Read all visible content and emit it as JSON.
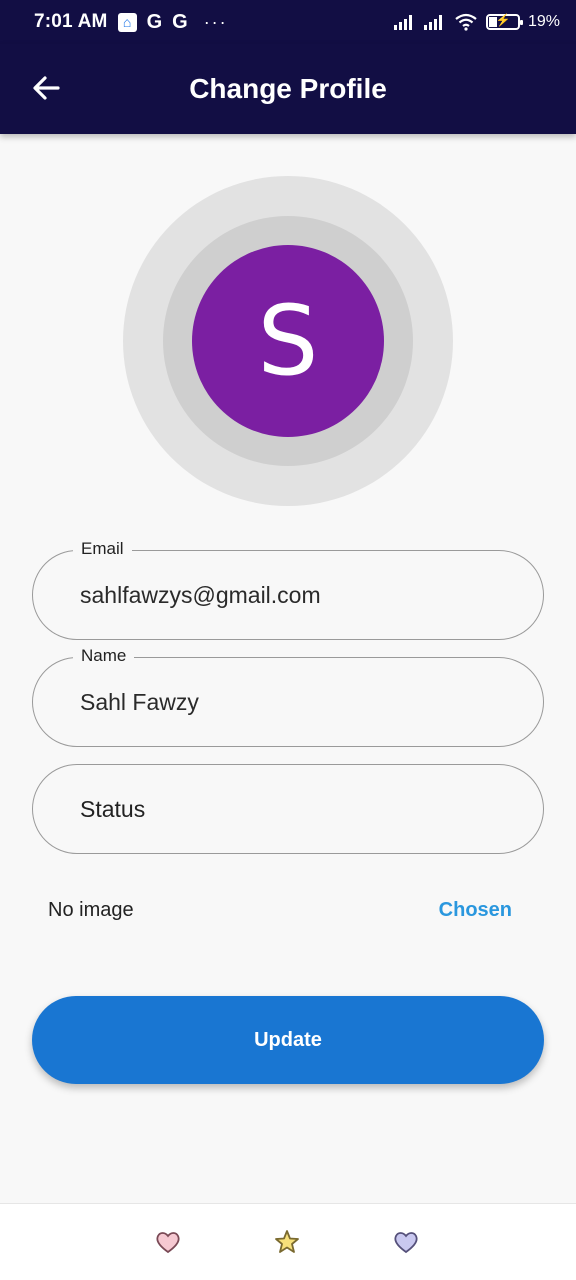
{
  "status_bar": {
    "time": "7:01 AM",
    "icons": [
      "home-app-icon",
      "google-icon",
      "google-icon",
      "more-dots-icon"
    ],
    "g1": "G",
    "g2": "G",
    "dots": "···",
    "battery": "19%"
  },
  "app_bar": {
    "title": "Change Profile",
    "back_icon": "arrow-left-icon"
  },
  "avatar": {
    "letter": "S",
    "color": "#7b1fa2"
  },
  "form": {
    "email": {
      "label": "Email",
      "value": "sahlfawzys@gmail.com"
    },
    "name": {
      "label": "Name",
      "value": "Sahl Fawzy"
    },
    "status": {
      "placeholder": "Status"
    }
  },
  "image_row": {
    "no_image": "No image",
    "chosen": "Chosen"
  },
  "update_button": {
    "label": "Update",
    "color": "#1976d2"
  },
  "bottom_nav": {
    "items": [
      "heart-icon",
      "star-icon",
      "heart-icon"
    ]
  }
}
